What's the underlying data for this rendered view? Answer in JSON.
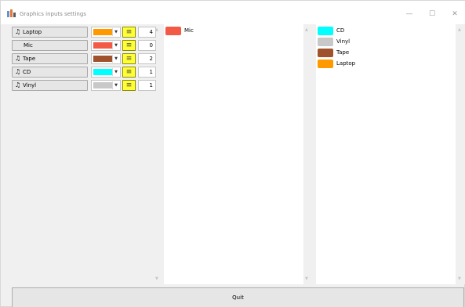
{
  "window": {
    "title": "Graphics inputs settings",
    "minimize": "—",
    "maximize": "☐",
    "close": "✕"
  },
  "inputs": [
    {
      "name": "Laptop",
      "color": "#ff9900",
      "count": "4",
      "has_icon": true
    },
    {
      "name": "Mic",
      "color": "#f25a46",
      "count": "0",
      "has_icon": false
    },
    {
      "name": "Tape",
      "color": "#a0522d",
      "count": "2",
      "has_icon": true
    },
    {
      "name": "CD",
      "color": "#00ffff",
      "count": "1",
      "has_icon": true
    },
    {
      "name": "Vinyl",
      "color": "#c8c8c8",
      "count": "1",
      "has_icon": true
    }
  ],
  "icons": {
    "note": "♫",
    "dropdown": "▼",
    "list": "≡"
  },
  "middle_panel": {
    "items": [
      {
        "label": "Mic",
        "color": "#f25a46"
      }
    ]
  },
  "right_panel": {
    "items": [
      {
        "label": "CD",
        "color": "#00ffff"
      },
      {
        "label": "Vinyl",
        "color": "#c8c8c8"
      },
      {
        "label": "Tape",
        "color": "#a0522d"
      },
      {
        "label": "Laptop",
        "color": "#ff9900"
      }
    ]
  },
  "quit_label": "Quit"
}
